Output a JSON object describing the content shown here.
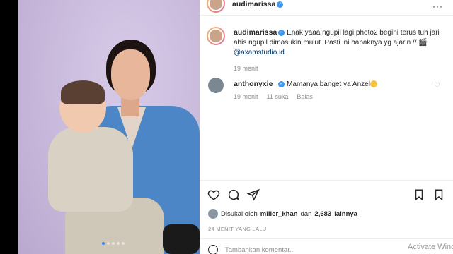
{
  "post": {
    "author": {
      "username": "audimarissa",
      "verified": true
    },
    "more_icon": "more-horizontal-icon",
    "caption": {
      "username": "audimarissa",
      "text": "Enak yaaa ngupil lagi photo2 begini terus tuh jari abis ngupil dimasukin mulut. Pasti ini bapaknya yg ajarin //",
      "camera_emoji": "🎬",
      "mention": "@axamstudio.id",
      "time": "19 menit"
    },
    "comment": {
      "username": "anthonyxie_",
      "text": "Mamanya banget ya Anzel",
      "time": "19 menit",
      "likes": "11 suka",
      "reply_label": "Balas"
    },
    "carousel": {
      "next_label": "›",
      "dot_count": 5,
      "active_index": 0
    },
    "likes": {
      "prefix": "Disukai oleh",
      "user": "miller_khan",
      "middle": "dan",
      "count": "2,683",
      "suffix": "lainnya"
    },
    "timestamp": "24 MENIT YANG LALU",
    "input": {
      "placeholder": "Tambahkan komentar..."
    }
  },
  "watermark": "Activate Windows",
  "colors": {
    "link": "#00376b",
    "verified": "#3897f0",
    "muted": "#8e8e8e",
    "media_bg": "#cdbfdf",
    "jacket": "#4d86c6"
  }
}
